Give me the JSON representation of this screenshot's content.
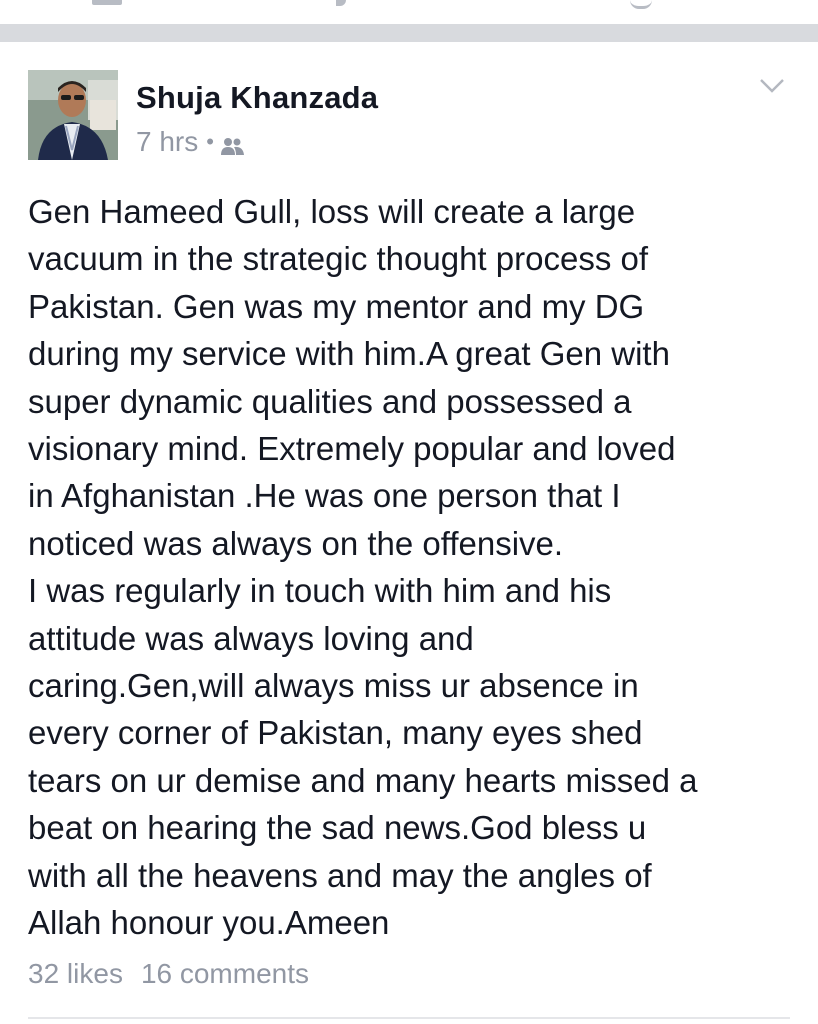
{
  "post": {
    "author_name": "Shuja Khanzada",
    "timestamp": "7 hrs",
    "separator": "•",
    "audience_icon": "friends-icon",
    "options_icon": "chevron-down-icon",
    "body_text": "Gen Hameed Gull, loss will create a large\nvacuum in the strategic thought process of\nPakistan. Gen was my mentor and my DG\nduring my service with him.A great Gen with\nsuper dynamic qualities and possessed a\nvisionary mind. Extremely popular and loved\nin Afghanistan .He was one person that I\nnoticed was always on the offensive.\nI was regularly in touch with him and his\nattitude was always loving and\ncaring.Gen,will always miss ur absence in\nevery corner of Pakistan, many eyes shed\ntears on ur demise and many hearts missed a\nbeat on hearing the sad news.God bless u\nwith all the heavens and may the angles of\nAllah honour you.Ameen",
    "likes_label": "32 likes",
    "comments_label": "16 comments"
  },
  "colors": {
    "primary_text": "#141823",
    "secondary_text": "#9197a3",
    "feed_gap": "#d8dade",
    "divider": "#e5e6e9"
  }
}
